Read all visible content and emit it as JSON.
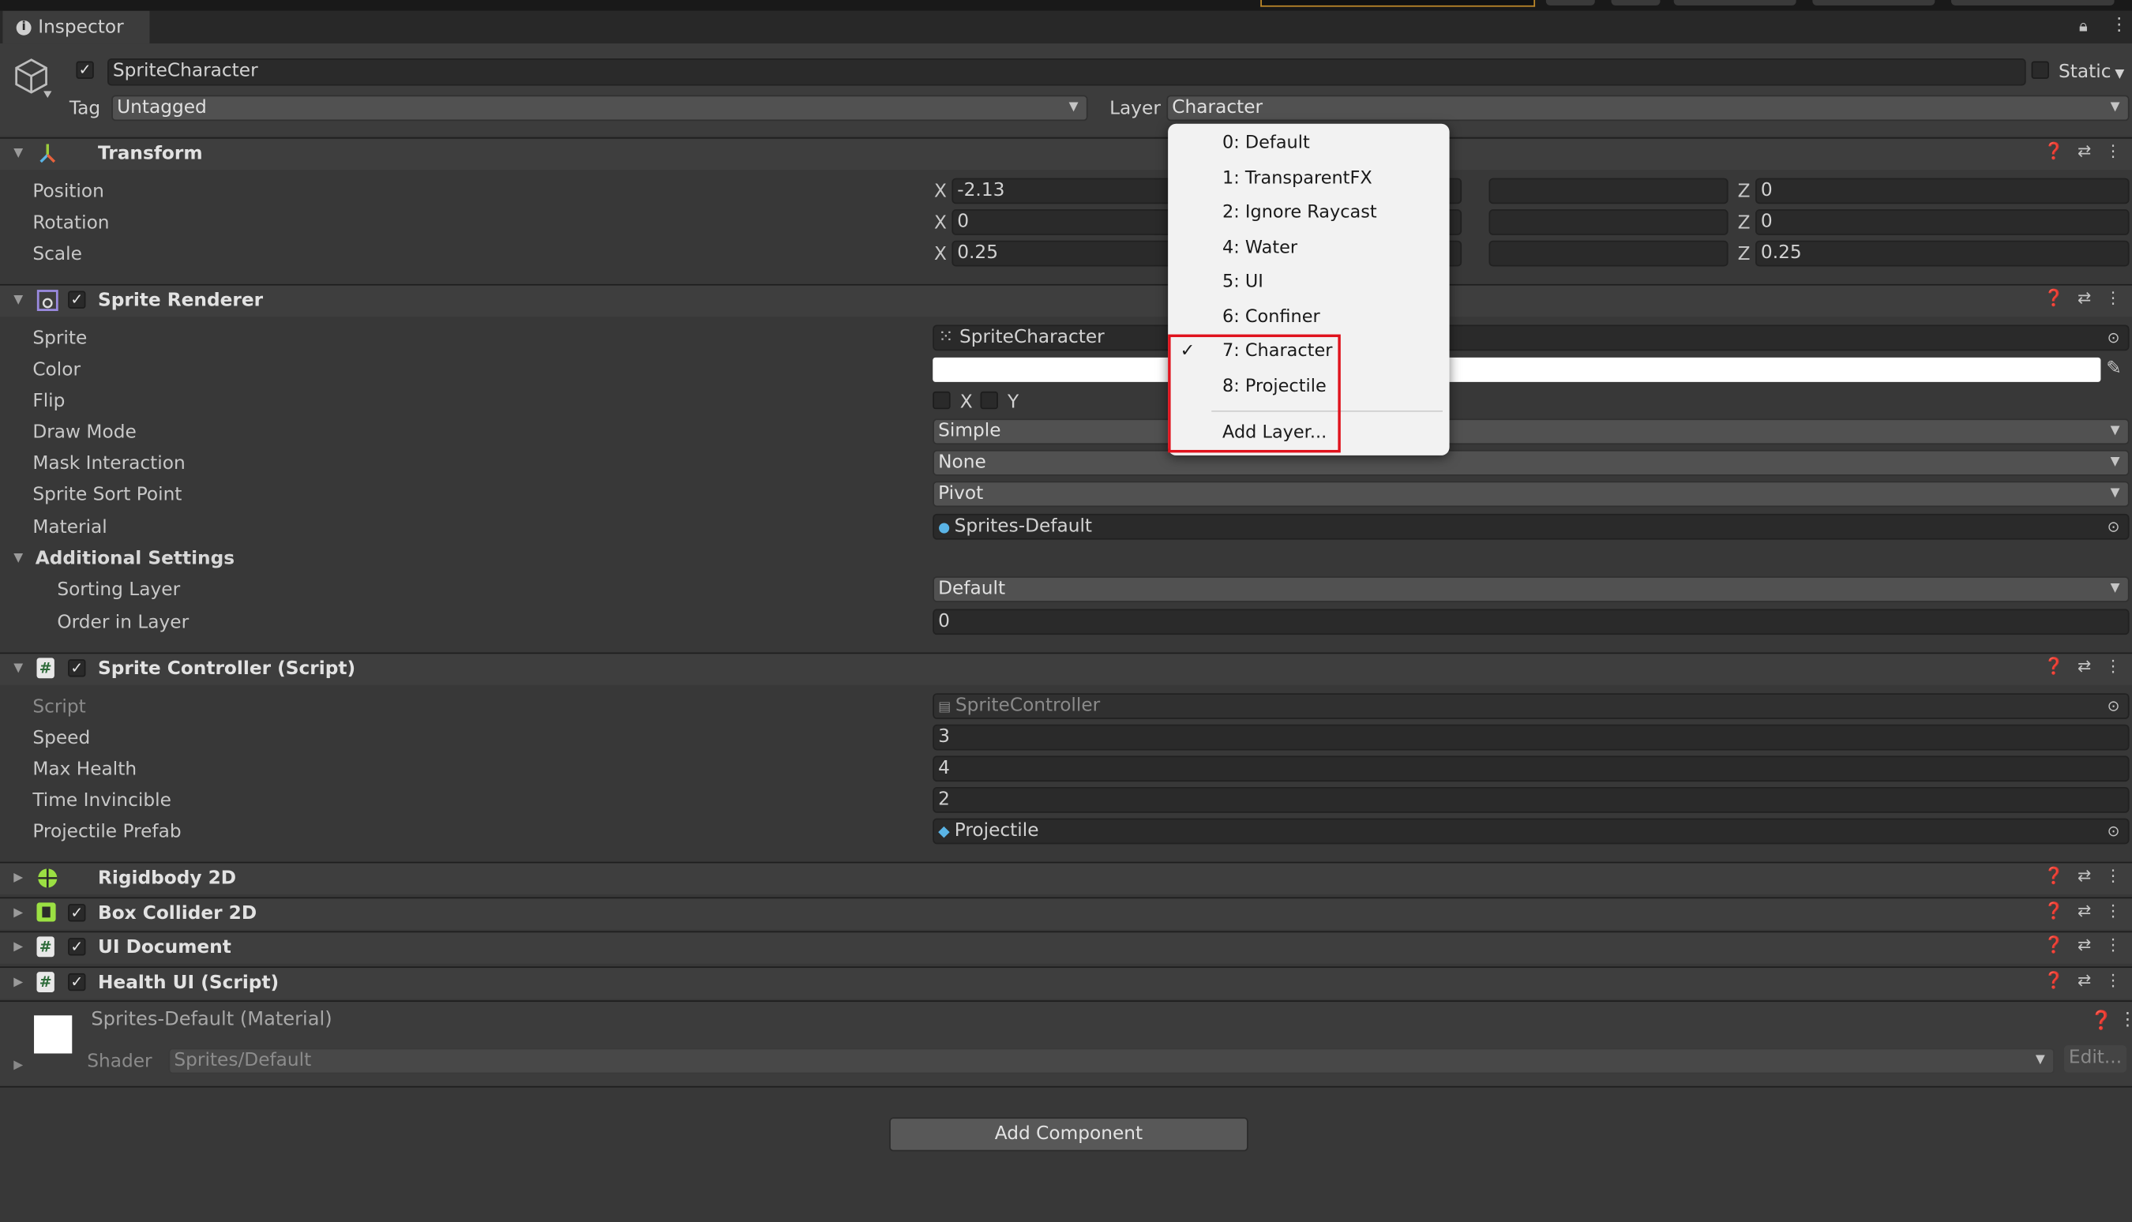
{
  "window": {
    "tab_label": "Inspector",
    "tab_icon": "info-icon",
    "lock_icon": "lock-icon",
    "menu_icon": "kebab-icon"
  },
  "object": {
    "active": true,
    "name": "SpriteCharacter",
    "static_label": "Static",
    "static_checked": false,
    "tag_label": "Tag",
    "tag_value": "Untagged",
    "layer_label": "Layer",
    "layer_value": "Character"
  },
  "transform": {
    "title": "Transform",
    "rows": [
      {
        "label": "Position",
        "x": "-2.13",
        "z": "0"
      },
      {
        "label": "Rotation",
        "x": "0",
        "z": "0"
      },
      {
        "label": "Scale",
        "x": "0.25",
        "z": "0.25"
      }
    ]
  },
  "sprite_renderer": {
    "title": "Sprite Renderer",
    "enabled": true,
    "sprite_label": "Sprite",
    "sprite_value": "SpriteCharacter",
    "color_label": "Color",
    "color_value": "#ffffff",
    "flip_label": "Flip",
    "flip_x": "X",
    "flip_y": "Y",
    "draw_mode_label": "Draw Mode",
    "draw_mode_value": "Simple",
    "mask_label": "Mask Interaction",
    "mask_value": "None",
    "sort_point_label": "Sprite Sort Point",
    "sort_point_value": "Pivot",
    "material_label": "Material",
    "material_value": "Sprites-Default",
    "additional_label": "Additional Settings",
    "sorting_layer_label": "Sorting Layer",
    "sorting_layer_value": "Default",
    "order_label": "Order in Layer",
    "order_value": "0"
  },
  "sprite_controller": {
    "title": "Sprite Controller (Script)",
    "enabled": true,
    "script_label": "Script",
    "script_value": "SpriteController",
    "speed_label": "Speed",
    "speed_value": "3",
    "max_health_label": "Max Health",
    "max_health_value": "4",
    "time_inv_label": "Time Invincible",
    "time_inv_value": "2",
    "proj_label": "Projectile Prefab",
    "proj_value": "Projectile"
  },
  "collapsed_components": [
    {
      "title": "Rigidbody 2D",
      "has_toggle": false,
      "icon": "rigidbody-icon"
    },
    {
      "title": "Box Collider 2D",
      "has_toggle": true,
      "icon": "box-collider-icon"
    },
    {
      "title": "UI Document",
      "has_toggle": true,
      "icon": "script-icon"
    },
    {
      "title": "Health UI (Script)",
      "has_toggle": true,
      "icon": "script-icon"
    }
  ],
  "material": {
    "title": "Sprites-Default (Material)",
    "shader_label": "Shader",
    "shader_value": "Sprites/Default",
    "edit_label": "Edit..."
  },
  "add_component_label": "Add Component",
  "layer_menu": {
    "items": [
      {
        "label": "0: Default",
        "checked": false
      },
      {
        "label": "1: TransparentFX",
        "checked": false
      },
      {
        "label": "2: Ignore Raycast",
        "checked": false
      },
      {
        "label": "4: Water",
        "checked": false
      },
      {
        "label": "5: UI",
        "checked": false
      },
      {
        "label": "6: Confiner",
        "checked": false
      },
      {
        "label": "7: Character",
        "checked": true
      },
      {
        "label": "8: Projectile",
        "checked": false
      }
    ],
    "add_label": "Add Layer...",
    "highlight_color": "#e0121d"
  }
}
